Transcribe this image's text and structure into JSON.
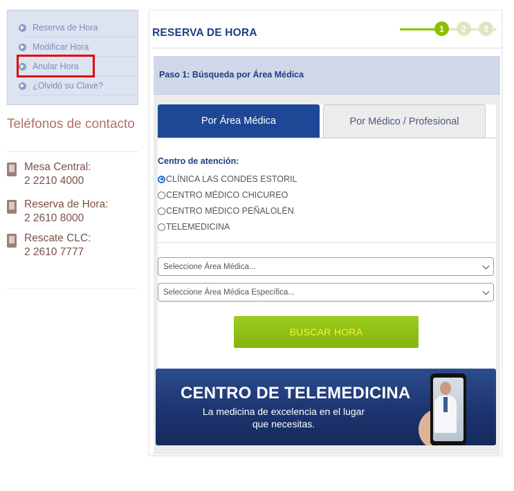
{
  "sidebar": {
    "menu": [
      {
        "label": "Reserva de Hora"
      },
      {
        "label": "Modificar Hora"
      },
      {
        "label": "Anular Hora"
      },
      {
        "label": "¿Olvidó su Clave?"
      }
    ],
    "contact_title": "Teléfonos de contacto",
    "phones": [
      {
        "label": "Mesa Central:",
        "number": "2 2210 4000"
      },
      {
        "label": "Reserva de Hora:",
        "number": "2 2610 8000"
      },
      {
        "label": "Rescate CLC:",
        "number": "2 2610 7777"
      }
    ]
  },
  "main": {
    "title": "RESERVA DE HORA",
    "steps": [
      {
        "number": "1",
        "color": "#8cc000"
      },
      {
        "number": "2",
        "color": "#dfe6c4"
      },
      {
        "number": "3",
        "color": "#dfe6c4"
      }
    ],
    "step_header": "Paso 1: Búsqueda por Área Médica",
    "tabs": [
      {
        "label": "Por Área Médica",
        "active": true
      },
      {
        "label": "Por Médico / Profesional",
        "active": false
      }
    ],
    "center_label": "Centro de atención:",
    "centers": [
      {
        "label": "CLÍNICA LAS CONDES ESTORIL",
        "checked": true
      },
      {
        "label": "CENTRO MÉDICO CHICUREO",
        "checked": false
      },
      {
        "label": "CENTRO MÉDICO PEÑALOLÉN",
        "checked": false
      },
      {
        "label": "TELEMEDICINA",
        "checked": false
      }
    ],
    "select_area": {
      "value": "Seleccione Área Médica..."
    },
    "select_specific": {
      "value": "Seleccione Área Médica Específica..."
    },
    "search_button": "BUSCAR HORA",
    "banner": {
      "title": "CENTRO DE TELEMEDICINA",
      "subtitle": "La medicina de excelencia en el lugar que necesitas."
    }
  },
  "colors": {
    "brand_blue": "#1e4896",
    "accent_green": "#8cc000",
    "highlight_red": "#e00000",
    "contact_brown": "#7a4f47"
  }
}
